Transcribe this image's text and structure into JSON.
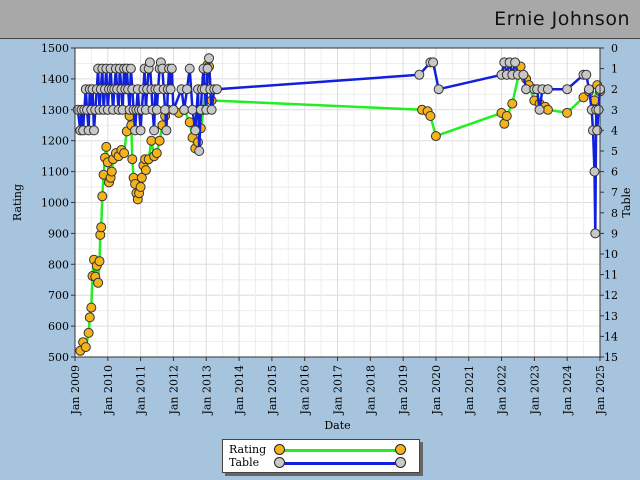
{
  "header": {
    "player_name": "Ernie Johnson"
  },
  "legend": {
    "rating_label": "Rating",
    "table_label": "Table"
  },
  "colors": {
    "background": "#a7c4de",
    "plot": "#ffffff",
    "rating_line": "#22ee22",
    "rating_marker": "#f4b21b",
    "table_line": "#1020dd",
    "table_marker": "#c8c8c8",
    "grid": "#dddddd"
  },
  "chart_data": {
    "type": "line",
    "title": "",
    "xlabel": "Date",
    "ylabel_left": "Rating",
    "ylabel_right": "Table",
    "x_ticks": [
      "Jan 2009",
      "Jan 2010",
      "Jan 2011",
      "Jan 2012",
      "Jan 2013",
      "Jan 2014",
      "Jan 2015",
      "Jan 2016",
      "Jan 2017",
      "Jan 2018",
      "Jan 2019",
      "Jan 2020",
      "Jan 2021",
      "Jan 2022",
      "Jan 2023",
      "Jan 2024",
      "Jan 2025"
    ],
    "x_range": [
      "2009-01-01",
      "2025-01-01"
    ],
    "ylim_left": [
      500,
      1500
    ],
    "yticks_left": [
      500,
      600,
      700,
      800,
      900,
      1000,
      1100,
      1200,
      1300,
      1400,
      1500
    ],
    "ylim_right": [
      15,
      0
    ],
    "yticks_right": [
      0,
      1,
      2,
      3,
      4,
      5,
      6,
      7,
      8,
      9,
      10,
      11,
      12,
      13,
      14,
      15
    ],
    "grid": true,
    "legend_position": "bottom-center",
    "series": [
      {
        "name": "Rating",
        "axis": "left",
        "points": [
          [
            "2009-03-01",
            520
          ],
          [
            "2009-04-01",
            548
          ],
          [
            "2009-05-01",
            532
          ],
          [
            "2009-06-01",
            578
          ],
          [
            "2009-06-15",
            628
          ],
          [
            "2009-07-01",
            660
          ],
          [
            "2009-07-15",
            762
          ],
          [
            "2009-08-01",
            815
          ],
          [
            "2009-08-15",
            760
          ],
          [
            "2009-09-01",
            795
          ],
          [
            "2009-09-15",
            740
          ],
          [
            "2009-10-01",
            810
          ],
          [
            "2009-10-10",
            895
          ],
          [
            "2009-10-20",
            920
          ],
          [
            "2009-11-01",
            1020
          ],
          [
            "2009-11-15",
            1090
          ],
          [
            "2009-12-01",
            1145
          ],
          [
            "2009-12-15",
            1180
          ],
          [
            "2010-01-01",
            1130
          ],
          [
            "2010-01-15",
            1065
          ],
          [
            "2010-02-01",
            1080
          ],
          [
            "2010-02-15",
            1100
          ],
          [
            "2010-03-01",
            1140
          ],
          [
            "2010-04-01",
            1160
          ],
          [
            "2010-05-01",
            1150
          ],
          [
            "2010-06-01",
            1170
          ],
          [
            "2010-07-01",
            1160
          ],
          [
            "2010-08-01",
            1230
          ],
          [
            "2010-09-01",
            1280
          ],
          [
            "2010-09-20",
            1250
          ],
          [
            "2010-10-01",
            1140
          ],
          [
            "2010-10-15",
            1080
          ],
          [
            "2010-11-01",
            1060
          ],
          [
            "2010-11-15",
            1030
          ],
          [
            "2010-12-01",
            1010
          ],
          [
            "2010-12-15",
            1030
          ],
          [
            "2011-01-01",
            1050
          ],
          [
            "2011-01-15",
            1080
          ],
          [
            "2011-02-01",
            1120
          ],
          [
            "2011-02-20",
            1140
          ],
          [
            "2011-03-01",
            1105
          ],
          [
            "2011-04-01",
            1140
          ],
          [
            "2011-05-01",
            1200
          ],
          [
            "2011-06-01",
            1150
          ],
          [
            "2011-07-01",
            1160
          ],
          [
            "2011-08-01",
            1200
          ],
          [
            "2011-09-01",
            1250
          ],
          [
            "2011-10-01",
            1280
          ],
          [
            "2011-11-01",
            1300
          ],
          [
            "2012-01-01",
            1300
          ],
          [
            "2012-03-01",
            1290
          ],
          [
            "2012-05-01",
            1300
          ],
          [
            "2012-07-01",
            1260
          ],
          [
            "2012-08-01",
            1210
          ],
          [
            "2012-09-01",
            1175
          ],
          [
            "2012-10-01",
            1195
          ],
          [
            "2012-11-01",
            1240
          ],
          [
            "2012-12-01",
            1300
          ],
          [
            "2013-01-01",
            1400
          ],
          [
            "2013-01-15",
            1445
          ],
          [
            "2013-02-01",
            1440
          ],
          [
            "2013-03-01",
            1330
          ],
          [
            "2019-08-01",
            1300
          ],
          [
            "2019-10-01",
            1295
          ],
          [
            "2019-11-01",
            1280
          ],
          [
            "2020-01-01",
            1215
          ],
          [
            "2022-01-01",
            1290
          ],
          [
            "2022-02-01",
            1255
          ],
          [
            "2022-03-01",
            1280
          ],
          [
            "2022-05-01",
            1320
          ],
          [
            "2022-08-01",
            1440
          ],
          [
            "2022-10-01",
            1400
          ],
          [
            "2022-11-01",
            1380
          ],
          [
            "2023-01-01",
            1330
          ],
          [
            "2023-03-01",
            1320
          ],
          [
            "2023-05-01",
            1310
          ],
          [
            "2023-06-01",
            1300
          ],
          [
            "2024-01-01",
            1290
          ],
          [
            "2024-07-01",
            1340
          ],
          [
            "2024-09-01",
            1360
          ],
          [
            "2024-11-01",
            1330
          ],
          [
            "2024-12-01",
            1380
          ],
          [
            "2025-01-01",
            1360
          ]
        ]
      },
      {
        "name": "Table",
        "axis": "right",
        "points": [
          [
            "2009-02-01",
            3
          ],
          [
            "2009-03-01",
            4
          ],
          [
            "2009-03-15",
            3
          ],
          [
            "2009-04-01",
            4
          ],
          [
            "2009-04-15",
            3
          ],
          [
            "2009-05-01",
            2
          ],
          [
            "2009-05-15",
            3
          ],
          [
            "2009-06-01",
            4
          ],
          [
            "2009-06-15",
            2
          ],
          [
            "2009-07-01",
            3
          ],
          [
            "2009-07-15",
            2
          ],
          [
            "2009-08-01",
            4
          ],
          [
            "2009-08-15",
            3
          ],
          [
            "2009-09-01",
            2
          ],
          [
            "2009-09-15",
            1
          ],
          [
            "2009-10-01",
            3
          ],
          [
            "2009-10-15",
            2
          ],
          [
            "2009-11-01",
            1
          ],
          [
            "2009-11-15",
            3
          ],
          [
            "2009-12-01",
            2
          ],
          [
            "2009-12-15",
            1
          ],
          [
            "2010-01-01",
            3
          ],
          [
            "2010-01-15",
            2
          ],
          [
            "2010-02-01",
            1
          ],
          [
            "2010-02-15",
            2
          ],
          [
            "2010-03-01",
            3
          ],
          [
            "2010-03-15",
            2
          ],
          [
            "2010-04-01",
            1
          ],
          [
            "2010-04-15",
            2
          ],
          [
            "2010-05-01",
            3
          ],
          [
            "2010-05-15",
            1
          ],
          [
            "2010-06-01",
            2
          ],
          [
            "2010-06-15",
            3
          ],
          [
            "2010-07-01",
            1
          ],
          [
            "2010-07-15",
            2
          ],
          [
            "2010-08-01",
            1
          ],
          [
            "2010-08-15",
            2
          ],
          [
            "2010-09-01",
            3
          ],
          [
            "2010-09-15",
            1
          ],
          [
            "2010-10-01",
            2
          ],
          [
            "2010-10-15",
            3
          ],
          [
            "2010-11-01",
            4
          ],
          [
            "2010-11-15",
            3
          ],
          [
            "2010-12-01",
            2
          ],
          [
            "2010-12-15",
            3
          ],
          [
            "2011-01-01",
            4
          ],
          [
            "2011-01-15",
            3
          ],
          [
            "2011-02-01",
            2
          ],
          [
            "2011-02-15",
            1
          ],
          [
            "2011-03-01",
            3
          ],
          [
            "2011-03-15",
            2
          ],
          [
            "2011-04-01",
            1
          ],
          [
            "2011-04-15",
            0.7
          ],
          [
            "2011-05-01",
            2
          ],
          [
            "2011-05-15",
            3
          ],
          [
            "2011-06-01",
            4
          ],
          [
            "2011-06-15",
            2
          ],
          [
            "2011-07-01",
            3
          ],
          [
            "2011-07-15",
            2
          ],
          [
            "2011-08-01",
            1
          ],
          [
            "2011-08-15",
            0.7
          ],
          [
            "2011-09-01",
            1
          ],
          [
            "2011-09-15",
            2
          ],
          [
            "2011-10-01",
            3
          ],
          [
            "2011-10-15",
            4
          ],
          [
            "2011-11-01",
            2
          ],
          [
            "2011-11-15",
            1
          ],
          [
            "2011-12-01",
            2
          ],
          [
            "2011-12-15",
            1
          ],
          [
            "2012-01-01",
            3
          ],
          [
            "2012-04-01",
            2
          ],
          [
            "2012-05-01",
            3
          ],
          [
            "2012-06-01",
            2
          ],
          [
            "2012-07-01",
            1
          ],
          [
            "2012-08-01",
            3
          ],
          [
            "2012-09-01",
            4
          ],
          [
            "2012-10-01",
            2
          ],
          [
            "2012-10-15",
            5
          ],
          [
            "2012-11-01",
            3
          ],
          [
            "2012-11-15",
            2
          ],
          [
            "2012-12-01",
            1
          ],
          [
            "2012-12-15",
            2
          ],
          [
            "2013-01-01",
            3
          ],
          [
            "2013-01-15",
            1
          ],
          [
            "2013-02-01",
            0.5
          ],
          [
            "2013-02-15",
            2
          ],
          [
            "2013-03-01",
            3
          ],
          [
            "2013-04-01",
            2
          ],
          [
            "2013-05-01",
            2
          ],
          [
            "2019-07-01",
            1.3
          ],
          [
            "2019-11-01",
            0.7
          ],
          [
            "2019-12-01",
            0.7
          ],
          [
            "2020-02-01",
            2
          ],
          [
            "2022-01-01",
            1.3
          ],
          [
            "2022-02-01",
            0.7
          ],
          [
            "2022-03-01",
            1.3
          ],
          [
            "2022-04-01",
            0.7
          ],
          [
            "2022-05-01",
            1.3
          ],
          [
            "2022-06-01",
            0.7
          ],
          [
            "2022-07-01",
            1.3
          ],
          [
            "2022-09-01",
            1.3
          ],
          [
            "2022-10-01",
            2
          ],
          [
            "2023-01-01",
            2
          ],
          [
            "2023-02-01",
            2
          ],
          [
            "2023-03-01",
            3
          ],
          [
            "2023-04-01",
            2
          ],
          [
            "2023-06-01",
            2
          ],
          [
            "2024-01-01",
            2
          ],
          [
            "2024-07-01",
            1.3
          ],
          [
            "2024-08-01",
            1.3
          ],
          [
            "2024-09-01",
            2
          ],
          [
            "2024-10-01",
            3
          ],
          [
            "2024-10-15",
            4
          ],
          [
            "2024-11-01",
            6
          ],
          [
            "2024-11-10",
            9
          ],
          [
            "2024-11-20",
            3
          ],
          [
            "2024-12-01",
            4
          ],
          [
            "2024-12-15",
            3
          ],
          [
            "2025-01-01",
            2
          ]
        ]
      }
    ]
  }
}
